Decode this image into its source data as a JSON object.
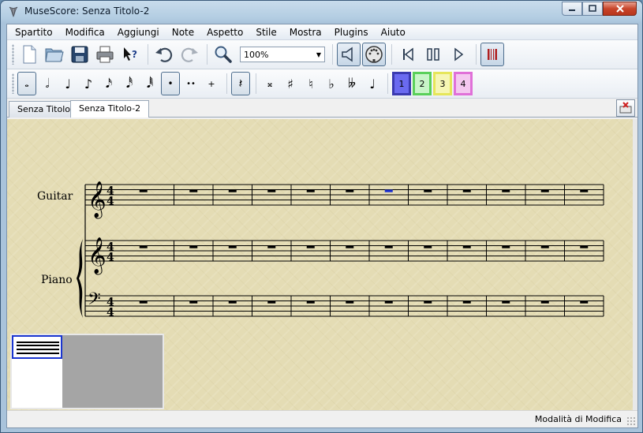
{
  "window": {
    "title": "MuseScore: Senza Titolo-2"
  },
  "menu": [
    "Spartito",
    "Modifica",
    "Aggiungi",
    "Note",
    "Aspetto",
    "Stile",
    "Mostra",
    "Plugins",
    "Aiuto"
  ],
  "toolbar": {
    "zoom_value": "100%"
  },
  "note_toolbar": {
    "voices": [
      {
        "label": "1",
        "color": "#6a6af0",
        "border": "#3a3ab0"
      },
      {
        "label": "2",
        "color": "#c8f5c8",
        "border": "#5ad05a"
      },
      {
        "label": "3",
        "color": "#f6f6b4",
        "border": "#e6e65a"
      },
      {
        "label": "4",
        "color": "#f4c8f0",
        "border": "#e070d8"
      }
    ]
  },
  "tabs": [
    {
      "label": "Senza Titolo"
    },
    {
      "label": "Senza Titolo-2"
    }
  ],
  "score": {
    "instruments": [
      {
        "name": "Guitar"
      },
      {
        "name": "Piano"
      }
    ],
    "time_signature": "4/4",
    "measures": 12,
    "selected_measure": 7,
    "selection_color": "#1a2fd0"
  },
  "status": {
    "mode": "Modalità di Modifica"
  }
}
